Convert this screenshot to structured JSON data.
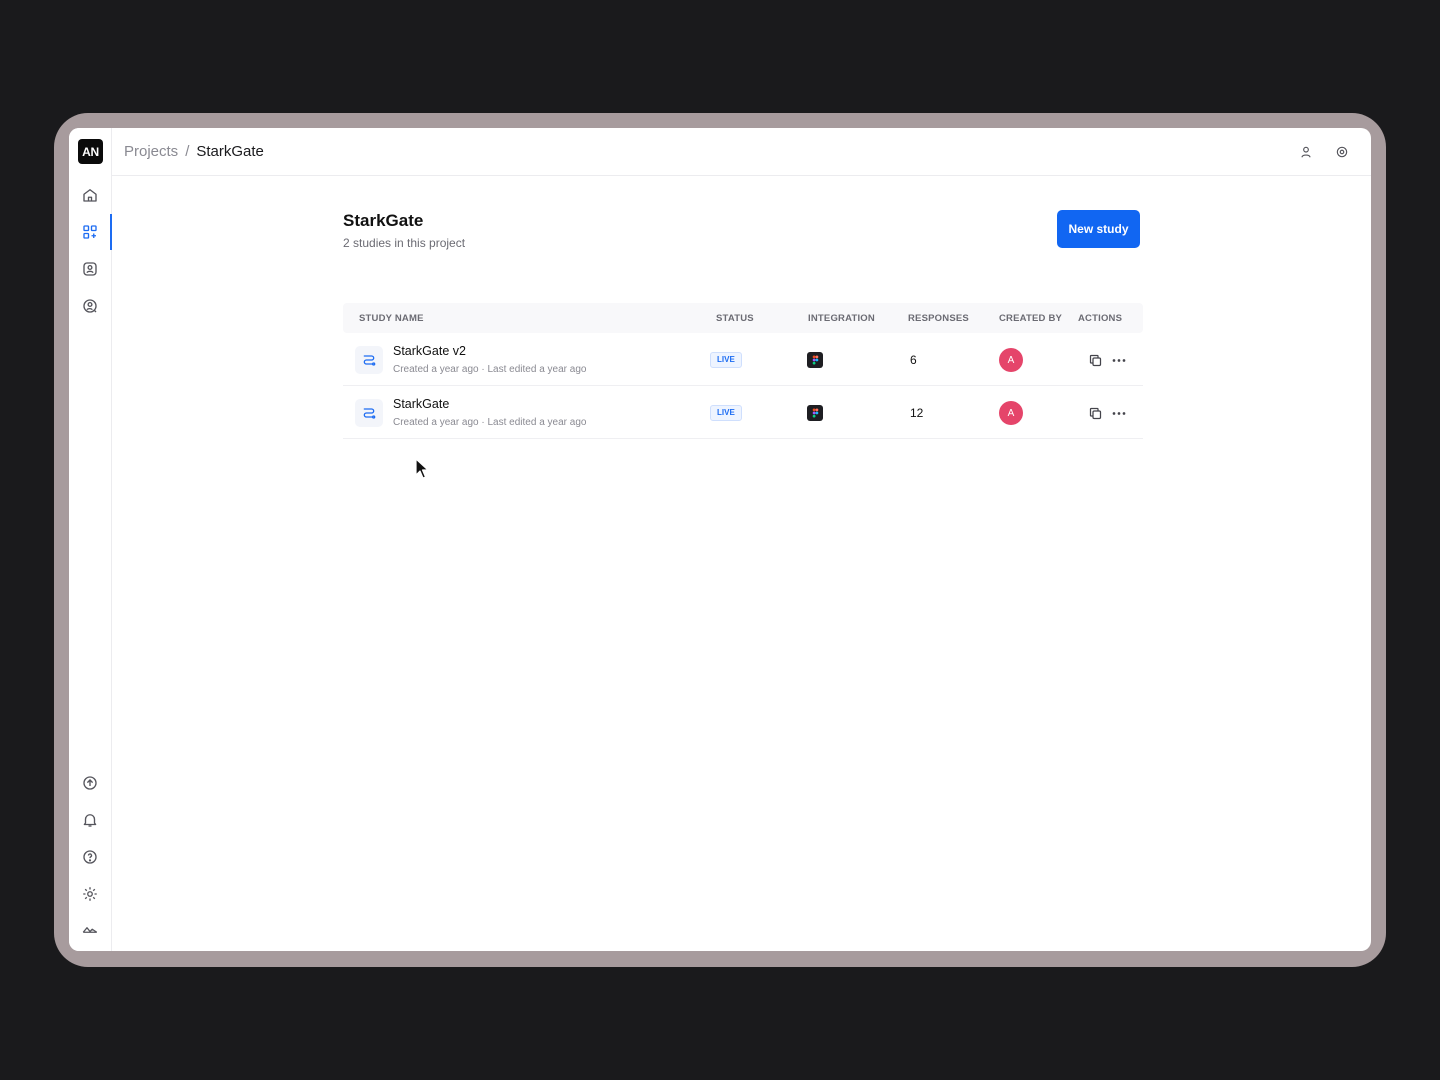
{
  "sidebar": {
    "logo": "AN",
    "top_items": [
      {
        "icon": "home-icon"
      },
      {
        "icon": "projects-grid-icon",
        "active": true
      },
      {
        "icon": "contacts-book-icon"
      },
      {
        "icon": "user-search-icon"
      }
    ],
    "bottom_items": [
      {
        "icon": "upload-icon"
      },
      {
        "icon": "bell-icon"
      },
      {
        "icon": "help-icon"
      },
      {
        "icon": "gear-icon"
      },
      {
        "icon": "brand-icon"
      }
    ]
  },
  "header": {
    "breadcrumb_root": "Projects",
    "breadcrumb_sep": "/",
    "breadcrumb_current": "StarkGate",
    "icons": [
      "user-icon",
      "settings-icon"
    ]
  },
  "main": {
    "title": "StarkGate",
    "subtitle": "2 studies in this project",
    "new_study_label": "New study",
    "columns": {
      "name": "STUDY NAME",
      "status": "STATUS",
      "integration": "INTEGRATION",
      "responses": "RESPONSES",
      "created_by": "CREATED BY",
      "actions": "ACTIONS"
    },
    "rows": [
      {
        "name": "StarkGate v2",
        "meta": "Created a year ago · Last edited a year ago",
        "status": "LIVE",
        "responses": "6",
        "creator_initial": "A"
      },
      {
        "name": "StarkGate",
        "meta": "Created a year ago · Last edited a year ago",
        "status": "LIVE",
        "responses": "12",
        "creator_initial": "A"
      }
    ]
  },
  "colors": {
    "accent": "#1166f2",
    "avatar": "#e5456a",
    "device_frame": "#a79b9d",
    "background": "#1a1a1c"
  }
}
